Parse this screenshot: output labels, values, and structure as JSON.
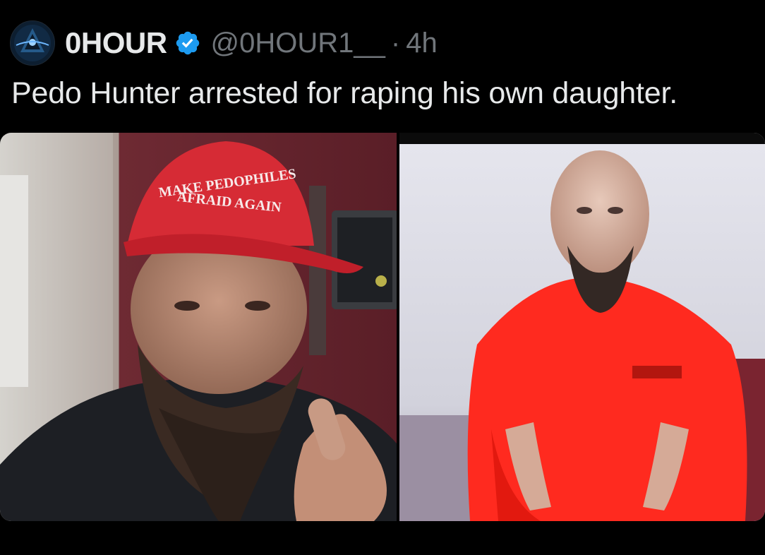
{
  "tweet": {
    "author_name": "0HOUR",
    "handle": "@0HOUR1__",
    "separator": "·",
    "time": "4h",
    "text": "Pedo Hunter arrested for raping his own daughter."
  },
  "media": {
    "left": {
      "cap_text_line1": "MAKE PEDOPHILES",
      "cap_text_line2": "AFRAID AGAIN"
    }
  },
  "icons": {
    "avatar": "avatar-icon",
    "verified": "verified-badge-icon"
  },
  "colors": {
    "background": "#000000",
    "text_primary": "#e7e9ea",
    "text_secondary": "#71767b",
    "verified_blue": "#1d9bf0",
    "cap_red": "#d62b35",
    "jumpsuit_red": "#ff2a1f"
  }
}
